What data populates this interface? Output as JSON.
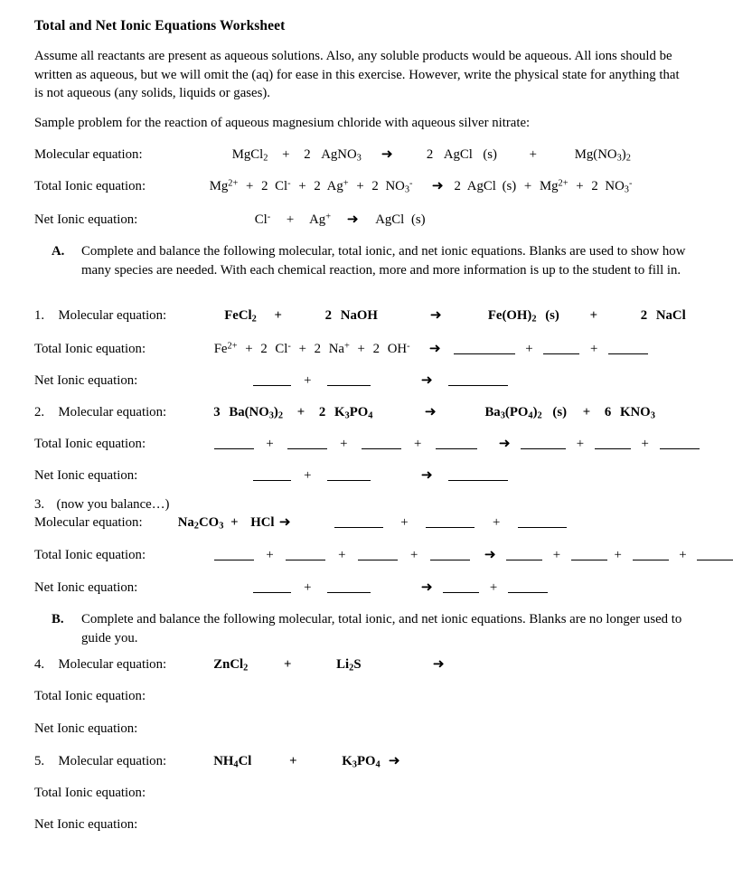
{
  "document": {
    "title": "Total and Net Ionic Equations Worksheet",
    "intro": "Assume all reactants are present as aqueous solutions.  Also, any soluble products would be aqueous.  All ions should be written as aqueous, but we will omit the (aq) for ease in this exercise.  However, write the physical state for anything that is not aqueous (any solids, liquids or gases).",
    "sample_lead": "Sample problem for the reaction of aqueous magnesium chloride with aqueous silver nitrate:"
  },
  "labels": {
    "molecular": "Molecular equation:",
    "total_ionic": "Total Ionic equation:",
    "net_ionic": "Net Ionic equation:",
    "num1": "1.",
    "num2": "2.",
    "num3": "3.",
    "num4": "4.",
    "num5": "5.",
    "molecular_numbered": "Molecular equation:",
    "balance_note": "(now you balance…)"
  },
  "sections": {
    "a": {
      "letter": "A.",
      "text": "Complete and balance the following molecular, total ionic, and net ionic equations.  Blanks are used to show how many species are needed.  With each chemical reaction, more and more information is up to the student to fill in."
    },
    "b": {
      "letter": "B.",
      "text": "Complete and balance the following molecular, total ionic, and net ionic equations.  Blanks are no longer used to guide you."
    }
  },
  "sample": {
    "molecular": {
      "reactant1": "MgCl",
      "reactant1_sub": "2",
      "plus": "+",
      "coeff2": "2",
      "reactant2": "AgNO",
      "reactant2_sub": "3",
      "arrow": "➜",
      "coeff3": "2",
      "product1": "AgCl",
      "product1_state": "(s)",
      "plus2": "+",
      "product2a": "Mg(NO",
      "product2_sub1": "3",
      "product2b": ")",
      "product2_sub2": "2"
    },
    "total_ionic": {
      "mg": "Mg",
      "mg_charge": "2+",
      "p1": "+",
      "c1": "2",
      "cl": "Cl",
      "cl_charge": "-",
      "p2": "+",
      "c2": "2",
      "ag": "Ag",
      "ag_charge": "+",
      "p3": "+",
      "c3": "2",
      "no3": "NO",
      "no3_sub": "3",
      "no3_charge": "-",
      "arrow": "➜",
      "c4": "2",
      "agcl": "AgCl",
      "agcl_state": "(s)",
      "p4": "+",
      "mg2": "Mg",
      "mg2_charge": "2+",
      "p5": "+",
      "c5": "2",
      "no3b": "NO",
      "no3b_sub": "3",
      "no3b_charge": "-"
    },
    "net_ionic": {
      "cl": "Cl",
      "cl_charge": "-",
      "plus": "+",
      "ag": "Ag",
      "ag_charge": "+",
      "arrow": "➜",
      "product": "AgCl",
      "product_state": "(s)"
    }
  },
  "problems": {
    "p1": {
      "molecular": {
        "r1": "FeCl",
        "r1_sub": "2",
        "plus": "+",
        "coeff2": "2",
        "r2": "NaOH",
        "arrow": "➜",
        "p1a": "Fe(OH)",
        "p1_sub": "2",
        "p1_state": "(s)",
        "plus2": "+",
        "coeff3": "2",
        "p2": "NaCl"
      },
      "total_ionic": {
        "fe": "Fe",
        "fe_charge": "2+",
        "s1": "+",
        "c1": "2",
        "cl": "Cl",
        "cl_charge": "-",
        "s2": "+",
        "c2": "2",
        "na": "Na",
        "na_charge": "+",
        "s3": "+",
        "c3": "2",
        "oh": "OH",
        "oh_charge": "-",
        "arrow": "➜",
        "plus_a": "+",
        "plus_b": "+"
      },
      "net_ionic": {
        "plus": "+",
        "arrow": "➜"
      }
    },
    "p2": {
      "molecular": {
        "coeff1": "3",
        "r1a": "Ba(NO",
        "r1_sub1": "3",
        "r1b": ")",
        "r1_sub2": "2",
        "plus": "+",
        "coeff2": "2",
        "r2a": "K",
        "r2_sub1": "3",
        "r2b": "PO",
        "r2_sub2": "4",
        "arrow": "➜",
        "p1a": "Ba",
        "p1_sub1": "3",
        "p1b": "(PO",
        "p1_sub2": "4",
        "p1c": ")",
        "p1_sub3": "2",
        "p1_state": "(s)",
        "plus2": "+",
        "coeff3": "6",
        "p2a": "KNO",
        "p2_sub": "3"
      },
      "total_ionic": {
        "s1": "+",
        "s2": "+",
        "s3": "+",
        "arrow": "➜",
        "s4": "+",
        "s5": "+"
      },
      "net_ionic": {
        "plus": "+",
        "arrow": "➜"
      }
    },
    "p3": {
      "molecular": {
        "r1a": "Na",
        "r1_sub1": "2",
        "r1b": "CO",
        "r1_sub2": "3",
        "plus": "+",
        "r2": "HCl",
        "arrow": "➜",
        "s1": "+",
        "s2": "+"
      },
      "total_ionic": {
        "s1": "+",
        "s2": "+",
        "s3": "+",
        "arrow": "➜",
        "s4": "+",
        "s5": "+",
        "s6": "+"
      },
      "net_ionic": {
        "plus": "+",
        "arrow": "➜",
        "plus2": "+"
      }
    },
    "p4": {
      "molecular": {
        "r1": "ZnCl",
        "r1_sub": "2",
        "plus": "+",
        "r2a": "Li",
        "r2_sub": "2",
        "r2b": "S",
        "arrow": "➜"
      }
    },
    "p5": {
      "molecular": {
        "r1a": "NH",
        "r1_sub": "4",
        "r1b": "Cl",
        "plus": "+",
        "r2a": "K",
        "r2_sub1": "3",
        "r2b": "PO",
        "r2_sub2": "4",
        "arrow": "➜"
      }
    }
  }
}
